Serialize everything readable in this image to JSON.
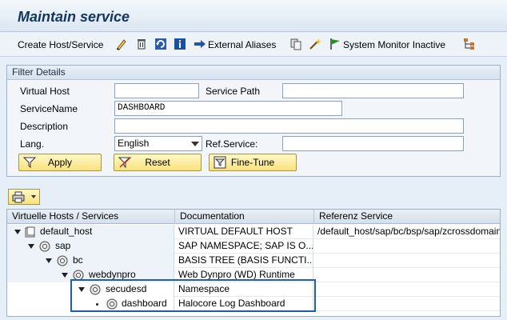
{
  "window": {
    "title": "Maintain service"
  },
  "toolbar": {
    "create_label": "Create Host/Service",
    "external_aliases_label": "External Aliases",
    "system_monitor_label": "System Monitor Inactive"
  },
  "filter": {
    "group_title": "Filter Details",
    "virtual_host_label": "Virtual Host",
    "virtual_host_value": "",
    "service_path_label": "Service Path",
    "service_path_value": "",
    "service_name_label": "ServiceName",
    "service_name_value": "DASHBOARD",
    "description_label": "Description",
    "description_value": "",
    "lang_label": "Lang.",
    "lang_value": "English",
    "ref_service_label": "Ref.Service:",
    "ref_service_value": "",
    "apply_label": "Apply",
    "reset_label": "Reset",
    "finetune_label": "Fine-Tune"
  },
  "tree": {
    "columns": [
      "Virtuelle Hosts / Services",
      "Documentation",
      "Referenz Service"
    ],
    "rows": [
      {
        "name": "default_host",
        "doc": "VIRTUAL DEFAULT HOST",
        "ref": "/default_host/sap/bc/bsp/sap/zcrossdomain"
      },
      {
        "name": "sap",
        "doc": "SAP NAMESPACE; SAP IS O...",
        "ref": ""
      },
      {
        "name": "bc",
        "doc": "BASIS TREE (BASIS FUNCTI...",
        "ref": ""
      },
      {
        "name": "webdynpro",
        "doc": "Web Dynpro (WD) Runtime",
        "ref": ""
      },
      {
        "name": "secudesd",
        "doc": "Namespace",
        "ref": ""
      },
      {
        "name": "dashboard",
        "doc": "Halocore Log Dashboard",
        "ref": ""
      }
    ]
  },
  "icons": [
    "edit-icon",
    "delete-icon",
    "refresh-icon",
    "info-icon",
    "arrow-right-icon",
    "copy-icon",
    "wizard-icon",
    "flag-icon",
    "hierarchy-icon",
    "print-icon",
    "filter-icon",
    "service-node-icon"
  ]
}
